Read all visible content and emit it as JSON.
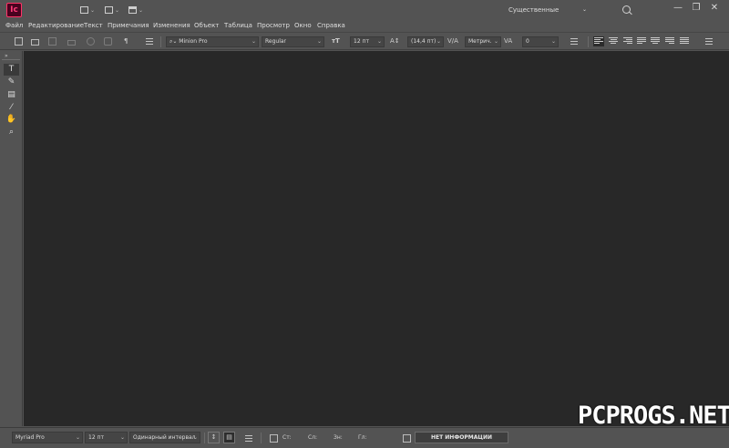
{
  "app": {
    "logo_text": "Ic"
  },
  "titlebar": {
    "workspace_label": "Существенные элементы",
    "minimize": "—",
    "restore": "❐",
    "close": "✕"
  },
  "menu": [
    "Файл",
    "Редактирование",
    "Текст",
    "Примечания",
    "Изменения",
    "Объект",
    "Таблица",
    "Просмотр",
    "Окно",
    "Справка"
  ],
  "control_panel": {
    "paragraph_symbol": "¶",
    "font_family": "Minion Pro",
    "font_style": "Regular",
    "font_size": "12 пт",
    "leading": "(14,4 пт)",
    "kerning": "Метрич.",
    "tracking": "0"
  },
  "tools": [
    {
      "name": "type-tool",
      "glyph": "T"
    },
    {
      "name": "position-tool",
      "glyph": "✎"
    },
    {
      "name": "note-tool",
      "glyph": "▤"
    },
    {
      "name": "eyedropper-tool",
      "glyph": "⁄"
    },
    {
      "name": "hand-tool",
      "glyph": "✋"
    },
    {
      "name": "zoom-tool",
      "glyph": "⌕"
    }
  ],
  "bottom_bar": {
    "font": "Myriad Pro",
    "size": "12 пт",
    "spacing": "Одинарный интервал",
    "stats": {
      "lines": "Ст:",
      "words": "Сл:",
      "chars": "Зн:",
      "depth": "Гл:"
    },
    "info_button": "НЕТ ИНФОРМАЦИИ"
  },
  "watermark": "PCPROGS.NET",
  "colors": {
    "chrome": "#535353",
    "canvas": "#282828",
    "brand": "#ff3a78",
    "brand_bg": "#49021f"
  }
}
